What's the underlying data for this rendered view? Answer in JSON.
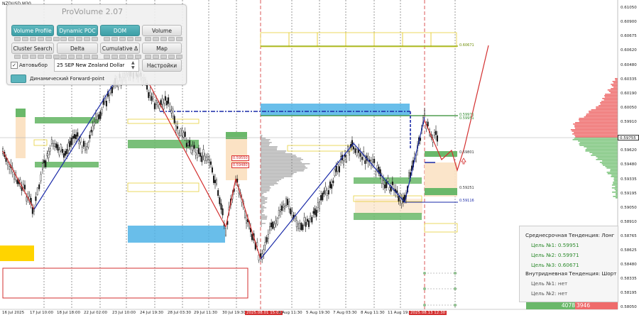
{
  "symbol": "NZDUSD,M30",
  "panel": {
    "title": "ProVolume 2.07",
    "buttons": {
      "volume_profile": "Volume Profile",
      "dynamic_poc": "Dynamic POC",
      "dom": "DOM",
      "volume": "Volume",
      "cluster_search": "Cluster Search",
      "delta": "Delta",
      "cumulative_delta": "Cumulative Δ",
      "map": "Map",
      "settings": "Настройки"
    },
    "auto_select_label": "Автовыбор",
    "auto_select_checked": "✓",
    "instrument": "25 SEP New Zealand Dollar",
    "forward_point_label": "Динамический Forward-point"
  },
  "price_axis": [
    "0.61050",
    "0.60900",
    "0.60675",
    "0.60620",
    "0.60480",
    "0.60335",
    "0.60190",
    "0.60050",
    "0.59910",
    "0.59620",
    "0.59480",
    "0.59335",
    "0.59195",
    "0.59050",
    "0.58910",
    "0.58765",
    "0.58625",
    "0.58480",
    "0.58335",
    "0.58195",
    "0.58050"
  ],
  "current_price": "0.59755",
  "time_axis": [
    "16 Jul 2025",
    "17 Jul 10:00",
    "18 Jul 18:00",
    "22 Jul 02:00",
    "23 Jul 10:00",
    "24 Jul 19:30",
    "28 Jul 03:30",
    "29 Jul 11:30",
    "30 Jul 19:30",
    "2025.08.01 15:00",
    "4 Aug 11:30",
    "5 Aug 19:30",
    "7 Aug 03:30",
    "8 Aug 11:30",
    "11 Aug 19:30",
    "2025.08.13 12:30"
  ],
  "levels": {
    "l1": "0.60671",
    "l2": "0.59971",
    "l3": "0.59951",
    "l4": "0.59801",
    "l5": "0.59251",
    "l6": "0.59116",
    "box1": "0.59550",
    "box2": "0.59480"
  },
  "trend_panel": {
    "medium_title": "Среднесрочная Тенденция: Лонг",
    "m1": "Цель №1: 0.59951",
    "m2": "Цель №2: 0.59971",
    "m3": "Цель №3: 0.60671",
    "intraday_title": "Внутридневная Тенденция: Шорт",
    "i1": "Цель №1: нет",
    "i2": "Цель №2: нет"
  },
  "volume_bar": {
    "buy": "4078",
    "sell": "3946"
  },
  "colors": {
    "accent": "#3b9ea6",
    "bull": "#2e8b2e",
    "bear": "#d32f2f",
    "zone_blue": "#4fb3e6",
    "zone_orange": "#fbe2c4",
    "zone_green": "#6ab86a",
    "zone_yellow": "#ffd400"
  }
}
